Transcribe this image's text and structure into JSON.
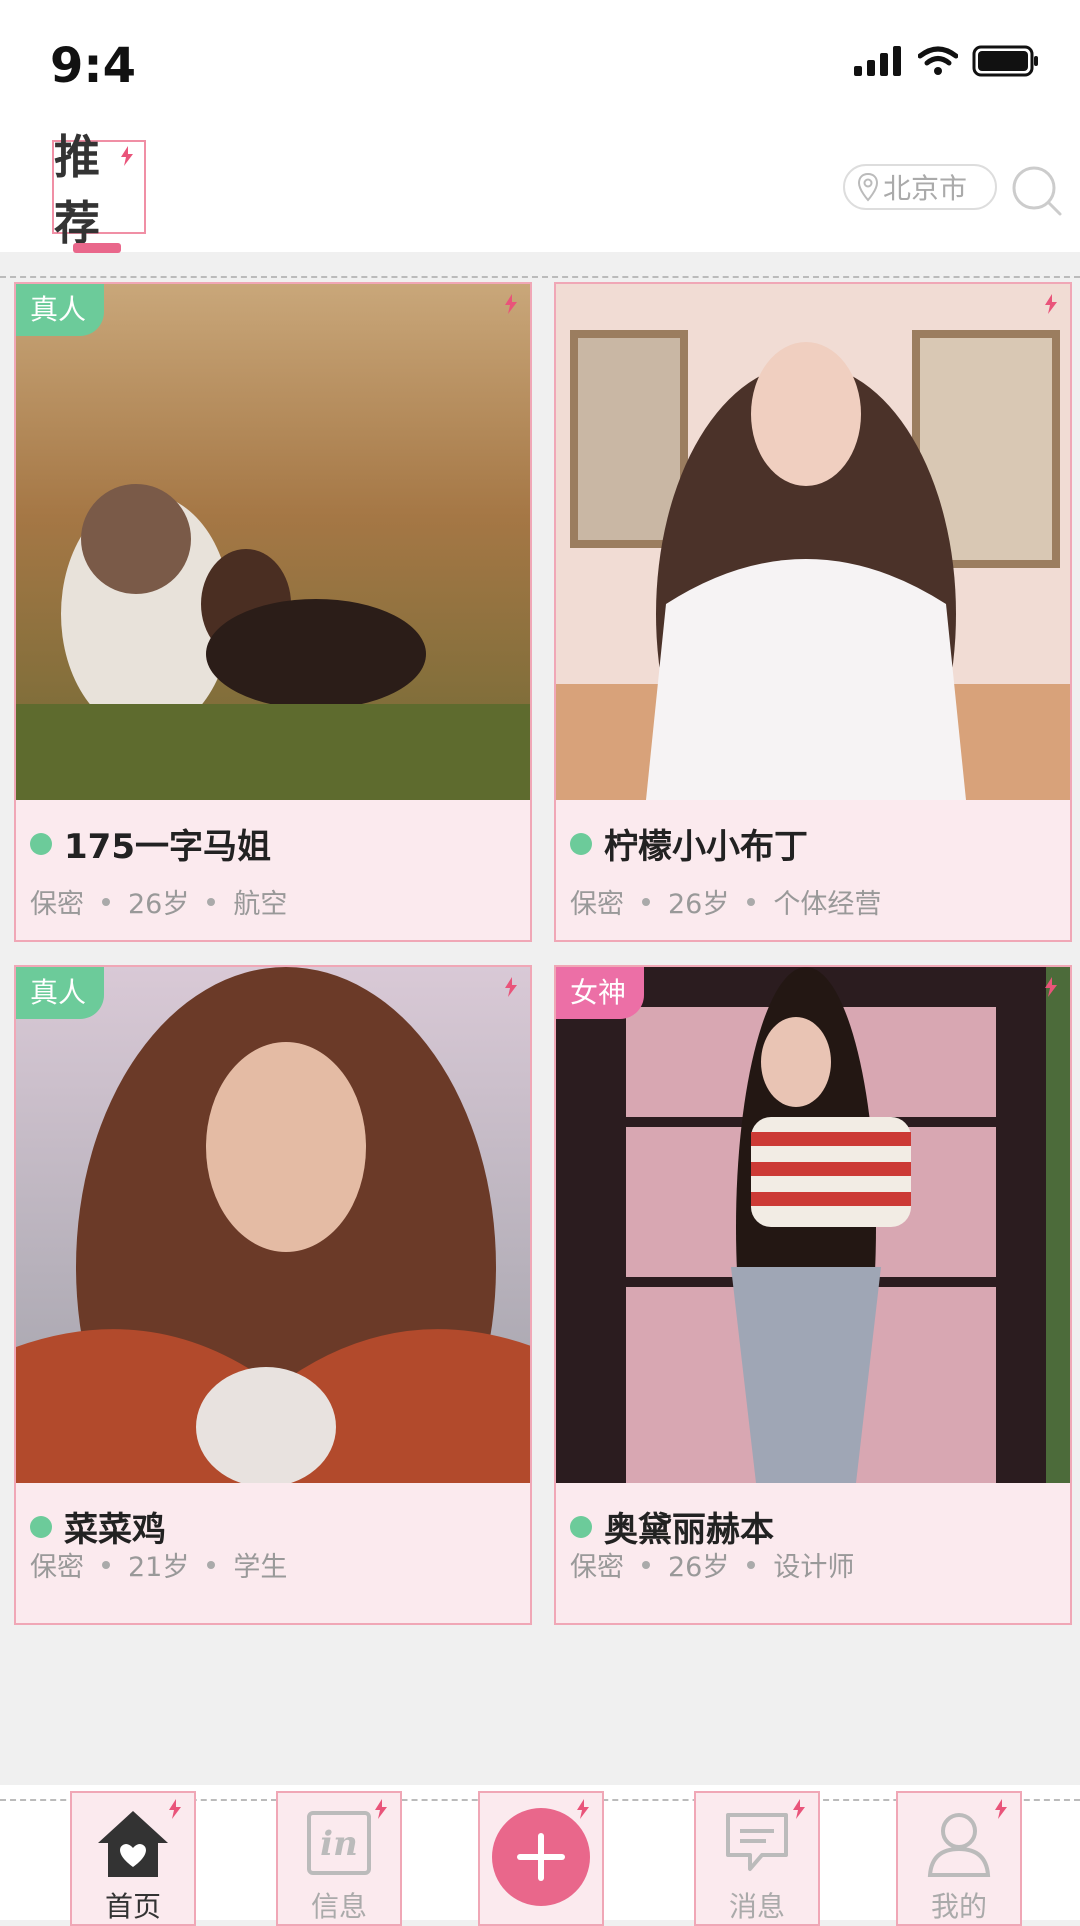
{
  "status_bar": {
    "time": "9:4"
  },
  "header": {
    "tab_label": "推荐",
    "location": "北京市"
  },
  "cards": [
    {
      "name": "175一字马姐",
      "badge": "真人",
      "meta": [
        "保密",
        "26岁",
        "航空"
      ]
    },
    {
      "name": "柠檬小小布丁",
      "badge": "",
      "meta": [
        "保密",
        "26岁",
        "个体经营"
      ]
    },
    {
      "name": "菜菜鸡",
      "badge": "真人",
      "meta": [
        "保密",
        "21岁",
        "学生"
      ]
    },
    {
      "name": "奥黛丽赫本",
      "badge": "女神",
      "meta": [
        "保密",
        "26岁",
        "设计师"
      ]
    }
  ],
  "tab_bar": [
    {
      "label": "首页"
    },
    {
      "label": "信息"
    },
    {
      "label": ""
    },
    {
      "label": "消息"
    },
    {
      "label": "我的"
    }
  ],
  "colors": {
    "accent": "#e9678b",
    "online": "#6ccb9a",
    "goddess": "#ec6fa6"
  }
}
